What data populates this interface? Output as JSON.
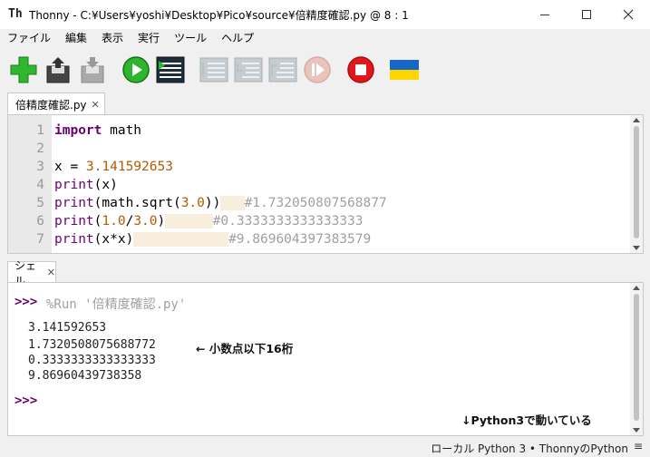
{
  "window": {
    "app_icon": "Th",
    "title": "Thonny  -  C:¥Users¥yoshi¥Desktop¥Pico¥source¥倍精度確認.py  @  8 : 1",
    "minimize": "minimize-icon",
    "maximize": "maximize-icon",
    "close": "close-icon"
  },
  "menu": [
    "ファイル",
    "編集",
    "表示",
    "実行",
    "ツール",
    "ヘルプ"
  ],
  "toolbar": {
    "icons": [
      "new-file-icon",
      "load-icon",
      "save-icon",
      "run-icon",
      "debug-icon",
      "step-over-icon",
      "step-into-icon",
      "step-out-icon",
      "resume-icon",
      "stop-icon",
      "ukraine-flag-icon"
    ]
  },
  "editor": {
    "tab_label": "倍精度確認.py",
    "tab_close": "✕",
    "line_numbers": [
      "1",
      "2",
      "3",
      "4",
      "5",
      "6",
      "7"
    ],
    "lines": {
      "l1_kw": "import",
      "l1_rest": " math",
      "l3_a": "x = ",
      "l3_num": "3.141592653",
      "l4_fn": "print",
      "l4_rest": "(x)",
      "l5_fn": "print",
      "l5_a": "(math.sqrt(",
      "l5_num": "3.0",
      "l5_b": "))",
      "l5_cmt": "#1.732050807568877",
      "l6_fn": "print",
      "l6_a": "(",
      "l6_num1": "1.0",
      "l6_b": "/",
      "l6_num2": "3.0",
      "l6_c": ")",
      "l6_cmt": "#0.3333333333333333",
      "l7_fn": "print",
      "l7_a": "(x*x)",
      "l7_cmt": "#9.869604397383579"
    }
  },
  "shell": {
    "tab_label": "シェル",
    "tab_close": "✕",
    "prompt": ">>>",
    "run_command": "%Run '倍精度確認.py'",
    "output": [
      "3.141592653",
      "1.7320508075688772",
      "0.3333333333333333",
      "9.86960439738358"
    ],
    "annotation_digits": "←  小数点以下16桁",
    "annotation_python": "↓Python3で動いている"
  },
  "status": {
    "interpreter": "ローカル Python 3  •  ThonnyのPython",
    "menu_glyph": "≡"
  }
}
